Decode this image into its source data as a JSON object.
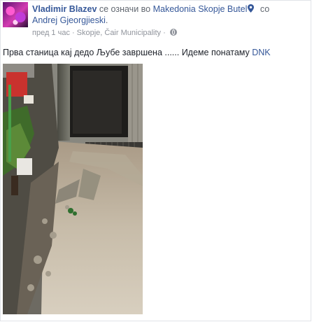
{
  "post": {
    "author": "Vladimir Blazev",
    "action_text": " се означи во ",
    "place": "Makedonia Skopje Butel",
    "with_text": " со",
    "tagged_person": "Andrej Gjeorgjieski",
    "tagged_suffix": ".",
    "time": "пред 1 час",
    "location": "Skopje, Čair Municipality",
    "separator": "·",
    "body_text": "Прва станица кај дедо Љубе завршена ...... Идеме понатаму ",
    "hashtag": "DNK"
  },
  "icons": {
    "location_pin": "map-pin-icon",
    "privacy": "globe-icon"
  },
  "colors": {
    "link": "#365899",
    "meta_text": "#90949c",
    "body_text": "#1d2129"
  }
}
